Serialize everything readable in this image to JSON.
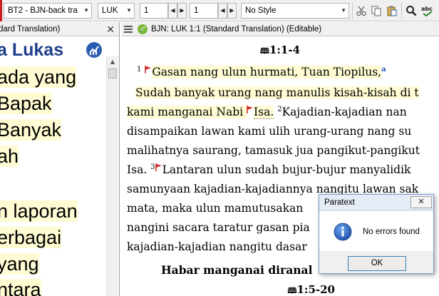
{
  "toolbar": {
    "project_combo": "BT2 - BJN-back tra",
    "book_combo": "LUK",
    "chapter_value": "1",
    "verse_value": "1",
    "style_combo": "No Style",
    "icons": [
      "cut-icon",
      "copy-icon",
      "paste-icon",
      "find-icon",
      "spellcheck-icon"
    ]
  },
  "left_pane": {
    "title": "dard Translation)",
    "heading": "a Lukas",
    "lines": [
      "ada yang",
      "Bapak",
      "Banyak",
      "ah",
      "",
      "n laporan",
      "erbagai",
      "yang",
      "ntara"
    ]
  },
  "right_pane": {
    "title": "BJN: LUK 1:1 (Standard Translation) (Editable)",
    "ref1": "1:1-4",
    "v1_num": "1",
    "v1_text": "Gasan nang ulun hurmati, Tuan Tiopilus,",
    "v1_fn": "a",
    "line2": "Sudah banyak urang nang manulis kisah-kisah di t",
    "line3a": "kami manganai Nabi ",
    "line3b": "Isa.",
    "v2_num": "2",
    "line3c": "Kajadian-kajadian nan",
    "line4": "disampaikan lawan kami ulih urang-urang nang su",
    "line5": "malihatnya saurang, tamasuk jua pangikut-pangikut",
    "line6a": "Isa.",
    "v3_num": "3",
    "line6b": "Lantaran ulun sudah bujur-bujur manyalidik",
    "line7": "samunyaan kajadian-kajadiannya nangitu lawan sak",
    "line8": "mata, maka ulun mamutusakan",
    "line9": "nangini sacara taratur gasan pia",
    "line10": "kajadian-kajadian nangitu dasar",
    "section_heading": "Habar manganai diranal",
    "ref2": "1:5-20"
  },
  "dialog": {
    "title": "Paratext",
    "close_label": "✕",
    "message": "No errors found",
    "ok_label": "OK"
  },
  "colors": {
    "highlight": "#fffbd2",
    "heading_blue": "#1f3f8a",
    "flag_red": "#d42020",
    "toolbar_red": "#c81e1e"
  }
}
